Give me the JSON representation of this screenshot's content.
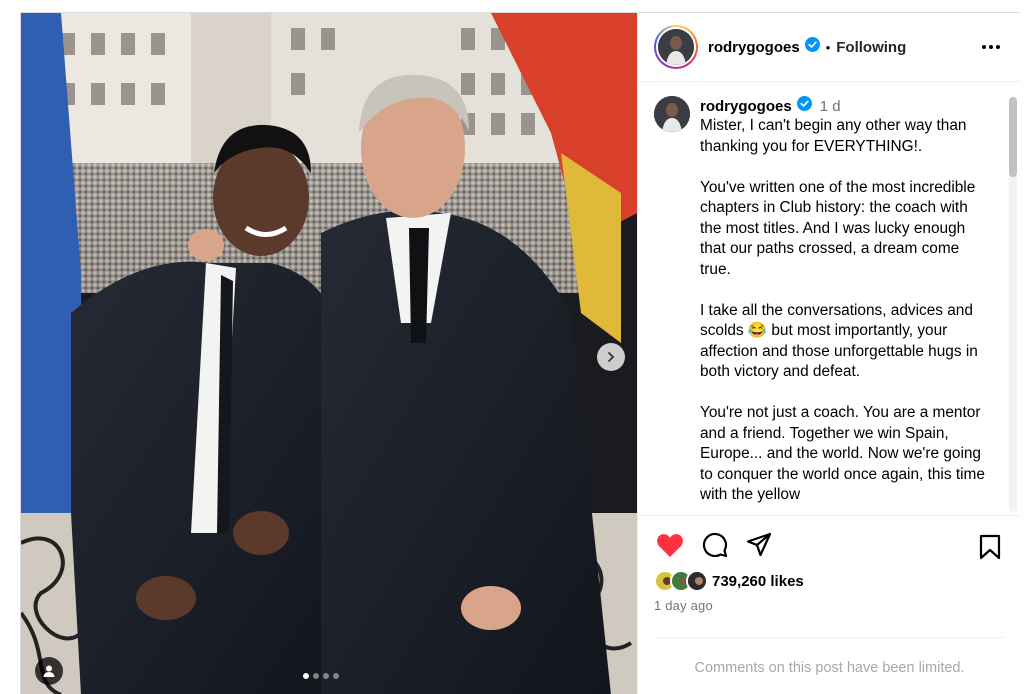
{
  "header": {
    "username": "rodrygogoes",
    "follow_status": "Following",
    "separator": "•"
  },
  "caption": {
    "username": "rodrygogoes",
    "time": "1 d",
    "text": "Mister, I can't begin any other way than thanking you for EVERYTHING!.\n\nYou've written one of the most incredible chapters in Club history: the coach with the most titles. And I was lucky enough that our paths crossed, a dream come true.\n\nI take all the conversations, advices and scolds 😂 but most importantly, your affection and those unforgettable hugs in both victory and defeat.\n\nYou're not just a coach. You are a mentor and a friend. Together we win Spain, Europe... and the world. Now we're going to conquer the world once again, this time with the yellow"
  },
  "engagement": {
    "likes": "739,260 likes",
    "time_ago": "1 day ago",
    "comments_notice": "Comments on this post have been limited."
  },
  "carousel": {
    "slides": 4,
    "active_index": 0
  },
  "icons": {
    "like": "heart-filled-icon",
    "comment": "comment-icon",
    "share": "share-icon",
    "save": "bookmark-icon",
    "more": "more-options-icon",
    "verified": "verified-badge-icon",
    "next": "chevron-right-icon",
    "tags": "user-tag-icon"
  },
  "colors": {
    "like_red": "#ff3040",
    "verified_blue": "#0095f6",
    "muted_text": "#737373"
  }
}
